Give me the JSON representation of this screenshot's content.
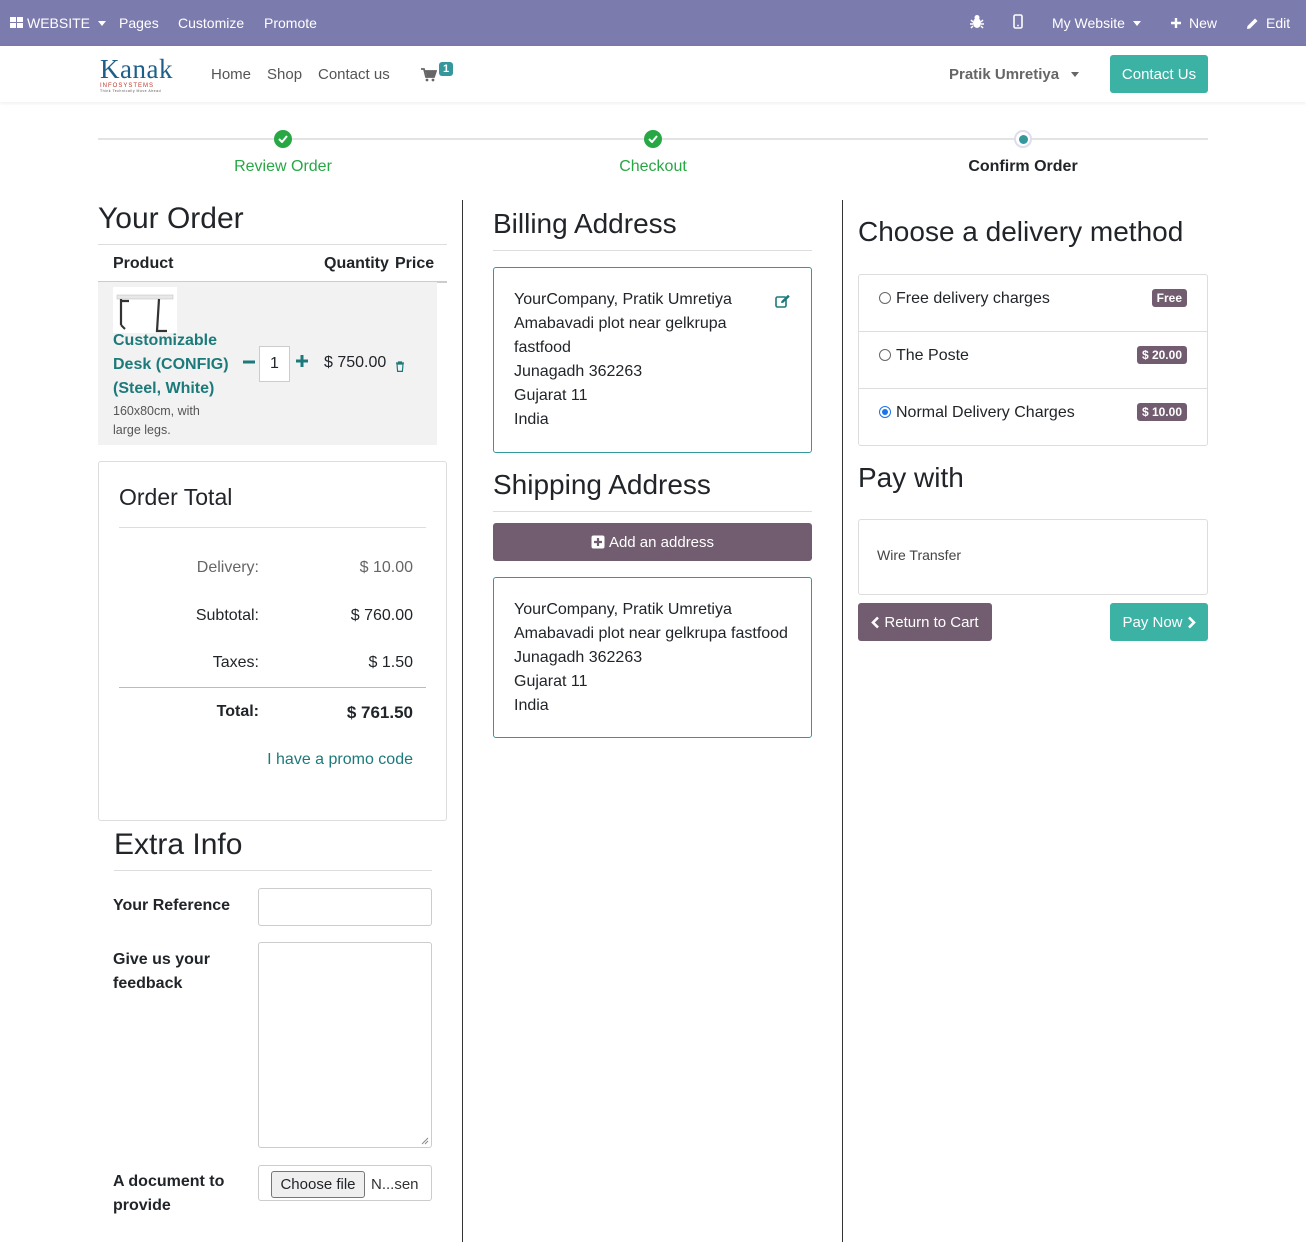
{
  "topbar": {
    "website": "WEBSITE",
    "pages": "Pages",
    "customize": "Customize",
    "promote": "Promote",
    "my_website": "My Website",
    "new": "New",
    "edit": "Edit"
  },
  "navbar": {
    "logo_main": "Kanak",
    "logo_sub": "INFOSYSTEMS",
    "logo_tagline": "Think Technically Move Ahead",
    "home": "Home",
    "shop": "Shop",
    "contact": "Contact us",
    "cart_count": "1",
    "user": "Pratik Umretiya",
    "contact_button": "Contact Us"
  },
  "steps": [
    {
      "label": "Review Order",
      "state": "done"
    },
    {
      "label": "Checkout",
      "state": "done"
    },
    {
      "label": "Confirm Order",
      "state": "current"
    }
  ],
  "order": {
    "title": "Your Order",
    "col_product": "Product",
    "col_quantity": "Quantity",
    "col_price": "Price",
    "product_name_1": "Customizable",
    "product_name_2": "Desk (CONFIG)",
    "product_name_3": "(Steel, White)",
    "product_desc_1": "160x80cm, with",
    "product_desc_2": "large legs.",
    "quantity": "1",
    "price": "$ 750.00"
  },
  "order_total": {
    "title": "Order Total",
    "delivery_label": "Delivery:",
    "delivery_value": "$ 10.00",
    "subtotal_label": "Subtotal:",
    "subtotal_value": "$ 760.00",
    "taxes_label": "Taxes:",
    "taxes_value": "$ 1.50",
    "total_label": "Total:",
    "total_value": "$ 761.50",
    "promo": "I have a promo code"
  },
  "extra_info": {
    "title": "Extra Info",
    "reference_label": "Your Reference",
    "feedback_label_1": "Give us your",
    "feedback_label_2": "feedback",
    "document_label_1": "A document to",
    "document_label_2": "provide",
    "choose_file": "Choose file",
    "no_file": "N...sen"
  },
  "billing": {
    "title": "Billing Address",
    "line1": "YourCompany, Pratik Umretiya",
    "line2": "Amabavadi plot near gelkrupa",
    "line3": "fastfood",
    "line4": "Junagadh 362263",
    "line5": "Gujarat 11",
    "line6": "India"
  },
  "shipping": {
    "title": "Shipping Address",
    "add_button": "Add an address",
    "line1": "YourCompany, Pratik Umretiya",
    "line2": "Amabavadi plot near gelkrupa fastfood",
    "line3": "Junagadh 362263",
    "line4": "Gujarat 11",
    "line5": "India"
  },
  "delivery": {
    "title": "Choose a delivery method",
    "options": [
      {
        "label": "Free delivery charges",
        "badge": "Free",
        "selected": false
      },
      {
        "label": "The Poste",
        "badge": "$ 20.00",
        "selected": false
      },
      {
        "label": "Normal Delivery Charges",
        "badge": "$ 10.00",
        "selected": true
      }
    ]
  },
  "payment": {
    "title": "Pay with",
    "method": "Wire Transfer",
    "return_button": "Return to Cart",
    "pay_button": "Pay Now"
  },
  "colors": {
    "topbar": "#7c7bad",
    "accent": "#35979c",
    "success": "#28a745",
    "secondary": "#725d70"
  }
}
